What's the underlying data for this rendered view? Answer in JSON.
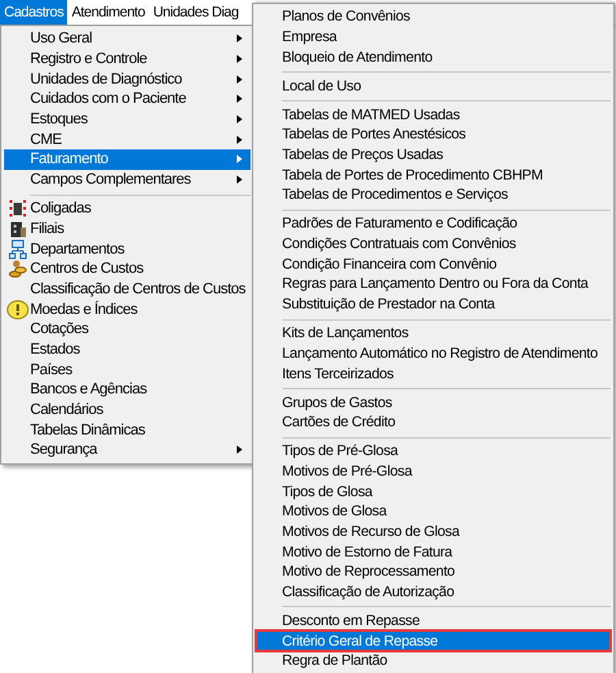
{
  "menubar": [
    {
      "label": "Cadastros",
      "selected": true
    },
    {
      "label": "Atendimento",
      "selected": false
    },
    {
      "label": "Unidades Diag",
      "selected": false
    }
  ],
  "main_menu": [
    {
      "kind": "item",
      "label": "Uso Geral",
      "submenu": true,
      "selected": false,
      "has_icon": false
    },
    {
      "kind": "item",
      "label": "Registro e Controle",
      "submenu": true,
      "selected": false,
      "has_icon": false
    },
    {
      "kind": "item",
      "label": "Unidades de Diagnóstico",
      "submenu": true,
      "selected": false,
      "has_icon": false
    },
    {
      "kind": "item",
      "label": "Cuidados com o Paciente",
      "submenu": true,
      "selected": false,
      "has_icon": false
    },
    {
      "kind": "item",
      "label": "Estoques",
      "submenu": true,
      "selected": false,
      "has_icon": false
    },
    {
      "kind": "item",
      "label": "CME",
      "submenu": true,
      "selected": false,
      "has_icon": false
    },
    {
      "kind": "item",
      "label": "Faturamento",
      "submenu": true,
      "selected": true,
      "has_icon": false
    },
    {
      "kind": "item",
      "label": "Campos Complementares",
      "submenu": true,
      "selected": false,
      "has_icon": false
    },
    {
      "kind": "separator"
    },
    {
      "kind": "item",
      "label": "Coligadas",
      "submenu": false,
      "selected": false,
      "has_icon": true
    },
    {
      "kind": "item",
      "label": "Filiais",
      "submenu": false,
      "selected": false,
      "has_icon": true
    },
    {
      "kind": "item",
      "label": "Departamentos",
      "submenu": false,
      "selected": false,
      "has_icon": true
    },
    {
      "kind": "item",
      "label": "Centros de Custos",
      "submenu": false,
      "selected": false,
      "has_icon": true
    },
    {
      "kind": "item",
      "label": "Classificação de Centros de Custos",
      "submenu": false,
      "selected": false,
      "has_icon": false
    },
    {
      "kind": "item",
      "label": "Moedas e Índices",
      "submenu": false,
      "selected": false,
      "has_icon": true
    },
    {
      "kind": "item",
      "label": "Cotações",
      "submenu": false,
      "selected": false,
      "has_icon": false
    },
    {
      "kind": "item",
      "label": "Estados",
      "submenu": false,
      "selected": false,
      "has_icon": false
    },
    {
      "kind": "item",
      "label": "Países",
      "submenu": false,
      "selected": false,
      "has_icon": false
    },
    {
      "kind": "item",
      "label": "Bancos e Agências",
      "submenu": false,
      "selected": false,
      "has_icon": false
    },
    {
      "kind": "item",
      "label": "Calendários",
      "submenu": false,
      "selected": false,
      "has_icon": false
    },
    {
      "kind": "item",
      "label": "Tabelas Dinâmicas",
      "submenu": false,
      "selected": false,
      "has_icon": false
    },
    {
      "kind": "item",
      "label": "Segurança",
      "submenu": true,
      "selected": false,
      "has_icon": false
    }
  ],
  "submenu": [
    {
      "kind": "item",
      "label": "Planos de Convênios",
      "selected": false,
      "outlined": false
    },
    {
      "kind": "item",
      "label": "Empresa",
      "selected": false,
      "outlined": false
    },
    {
      "kind": "item",
      "label": "Bloqueio de Atendimento",
      "selected": false,
      "outlined": false
    },
    {
      "kind": "separator"
    },
    {
      "kind": "item",
      "label": "Local de Uso",
      "selected": false,
      "outlined": false
    },
    {
      "kind": "separator"
    },
    {
      "kind": "item",
      "label": "Tabelas de MATMED Usadas",
      "selected": false,
      "outlined": false
    },
    {
      "kind": "item",
      "label": "Tabelas de Portes Anestésicos",
      "selected": false,
      "outlined": false
    },
    {
      "kind": "item",
      "label": "Tabelas de Preços Usadas",
      "selected": false,
      "outlined": false
    },
    {
      "kind": "item",
      "label": "Tabela de Portes de Procedimento CBHPM",
      "selected": false,
      "outlined": false
    },
    {
      "kind": "item",
      "label": "Tabelas de Procedimentos e Serviços",
      "selected": false,
      "outlined": false
    },
    {
      "kind": "separator"
    },
    {
      "kind": "item",
      "label": "Padrões de Faturamento e Codificação",
      "selected": false,
      "outlined": false
    },
    {
      "kind": "item",
      "label": "Condições Contratuais com Convênios",
      "selected": false,
      "outlined": false
    },
    {
      "kind": "item",
      "label": "Condição Financeira com Convênio",
      "selected": false,
      "outlined": false
    },
    {
      "kind": "item",
      "label": "Regras para Lançamento Dentro ou Fora da Conta",
      "selected": false,
      "outlined": false
    },
    {
      "kind": "item",
      "label": "Substituição de Prestador na Conta",
      "selected": false,
      "outlined": false
    },
    {
      "kind": "separator"
    },
    {
      "kind": "item",
      "label": "Kits de Lançamentos",
      "selected": false,
      "outlined": false
    },
    {
      "kind": "item",
      "label": "Lançamento Automático no Registro de Atendimento",
      "selected": false,
      "outlined": false
    },
    {
      "kind": "item",
      "label": "Itens Terceirizados",
      "selected": false,
      "outlined": false
    },
    {
      "kind": "separator"
    },
    {
      "kind": "item",
      "label": "Grupos de Gastos",
      "selected": false,
      "outlined": false
    },
    {
      "kind": "item",
      "label": "Cartões de Crédito",
      "selected": false,
      "outlined": false
    },
    {
      "kind": "separator"
    },
    {
      "kind": "item",
      "label": "Tipos de Pré-Glosa",
      "selected": false,
      "outlined": false
    },
    {
      "kind": "item",
      "label": "Motivos de Pré-Glosa",
      "selected": false,
      "outlined": false
    },
    {
      "kind": "item",
      "label": "Tipos de Glosa",
      "selected": false,
      "outlined": false
    },
    {
      "kind": "item",
      "label": "Motivos de Glosa",
      "selected": false,
      "outlined": false
    },
    {
      "kind": "item",
      "label": "Motivos de Recurso de Glosa",
      "selected": false,
      "outlined": false
    },
    {
      "kind": "item",
      "label": "Motivo de Estorno de Fatura",
      "selected": false,
      "outlined": false
    },
    {
      "kind": "item",
      "label": "Motivo de Reprocessamento",
      "selected": false,
      "outlined": false
    },
    {
      "kind": "item",
      "label": "Classificação de Autorização",
      "selected": false,
      "outlined": false
    },
    {
      "kind": "separator"
    },
    {
      "kind": "item",
      "label": "Desconto em Repasse",
      "selected": false,
      "outlined": false
    },
    {
      "kind": "item",
      "label": "Critério Geral de Repasse",
      "selected": true,
      "outlined": true
    },
    {
      "kind": "item",
      "label": "Regra de Plantão",
      "selected": false,
      "outlined": false
    }
  ]
}
